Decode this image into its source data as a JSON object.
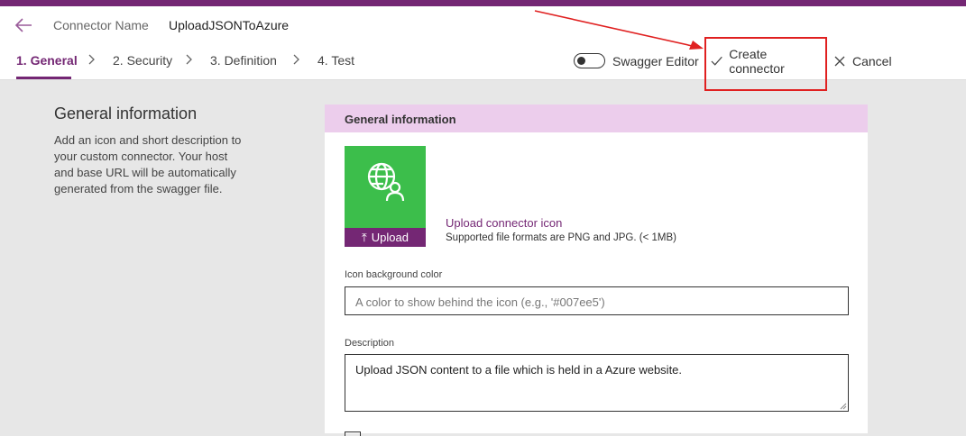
{
  "header": {
    "connector_name_label": "Connector Name",
    "connector_name_value": "UploadJSONToAzure"
  },
  "steps": [
    {
      "label": "1. General",
      "active": true
    },
    {
      "label": "2. Security",
      "active": false
    },
    {
      "label": "3. Definition",
      "active": false
    },
    {
      "label": "4. Test",
      "active": false
    }
  ],
  "toolbar": {
    "swagger_label": "Swagger Editor",
    "swagger_on": false,
    "create_label": "Create connector",
    "cancel_label": "Cancel"
  },
  "left": {
    "title": "General information",
    "description": "Add an icon and short description to your custom connector. Your host and base URL will be automatically generated from the swagger file."
  },
  "panel": {
    "title": "General information",
    "upload_label": "Upload",
    "upload_link": "Upload connector icon",
    "formats": "Supported file formats are PNG and JPG. (< 1MB)",
    "bg_color_label": "Icon background color",
    "bg_color_placeholder": "A color to show behind the icon (e.g., '#007ee5')",
    "description_label": "Description",
    "description_value": "Upload JSON content to a file which is held in a Azure website."
  },
  "colors": {
    "brand": "#742774",
    "icon_bg": "#3cbe4b",
    "panel_header": "#eccdec",
    "annotation": "#e02020"
  },
  "icons": {
    "back": "back-arrow-icon",
    "globe": "globe-user-icon",
    "check": "checkmark-icon",
    "cancel": "close-icon",
    "upload": "upload-arrow-icon"
  }
}
